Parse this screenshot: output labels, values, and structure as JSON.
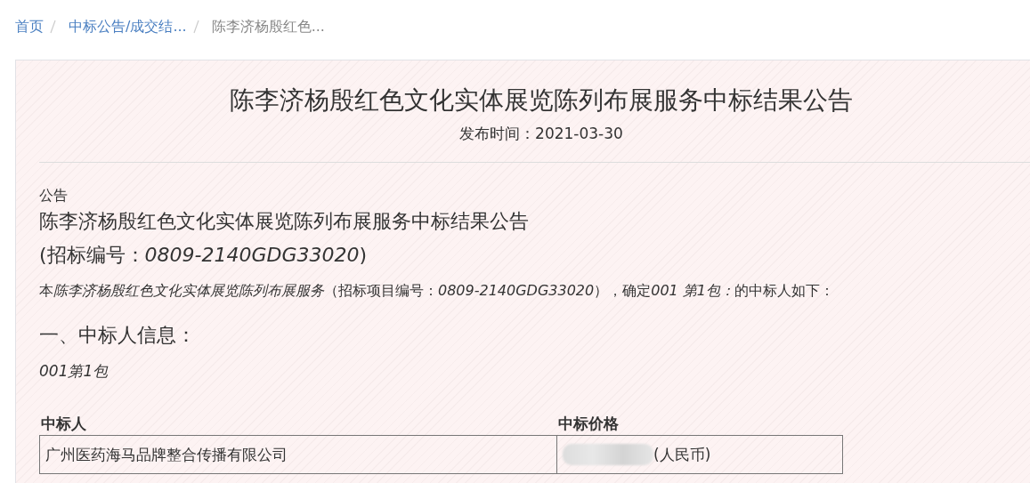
{
  "breadcrumb": [
    {
      "label": "首页",
      "link": true
    },
    {
      "label": "中标公告/成交结...",
      "link": true
    },
    {
      "label": "陈李济杨殷红色...",
      "link": false
    }
  ],
  "notice": {
    "title": "陈李济杨殷红色文化实体展览陈列布展服务中标结果公告",
    "publish_time": "发布时间：2021-03-30"
  },
  "body": {
    "label": "公告",
    "heading": "陈李济杨殷红色文化实体展览陈列布展服务中标结果公告",
    "tender_number": "(招标编号：*0809-2140GDG33020*)",
    "statement": [
      {
        "text": "本",
        "italic": false
      },
      {
        "text": "陈李济杨殷红色文化实体展览陈列布展服务",
        "italic": true
      },
      {
        "text": "（招标项目编号：",
        "italic": false
      },
      {
        "text": "0809-2140GDG33020",
        "italic": true
      },
      {
        "text": "），确定",
        "italic": false
      },
      {
        "text": "001 第1包：",
        "italic": true
      },
      {
        "text": "的中标人如下：",
        "italic": false
      }
    ],
    "section_title": "一、中标人信息：",
    "package": "001第1包",
    "table": {
      "columns": [
        "中标人",
        "中标价格"
      ],
      "rows": [
        {
          "cells": [
            "广州医药海马品牌整合传播有限公司",
            "(人民币)"
          ]
        }
      ]
    }
  }
}
